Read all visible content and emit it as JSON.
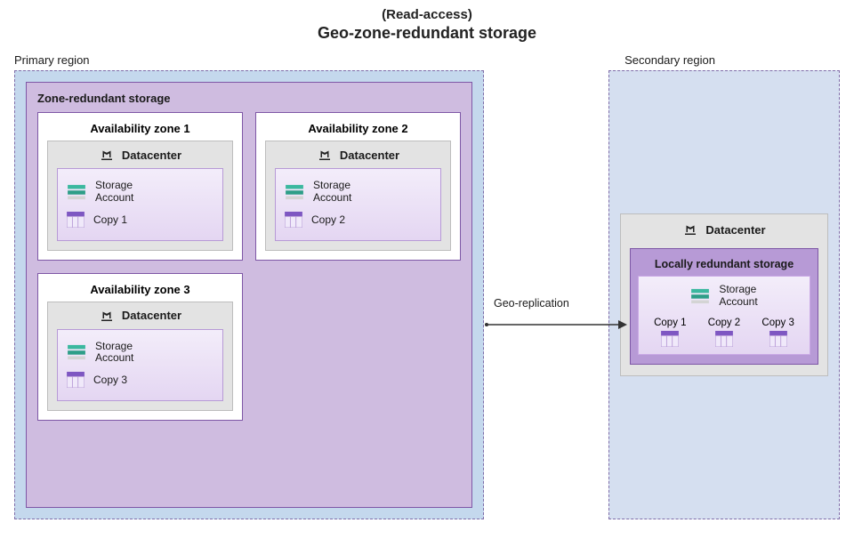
{
  "header": {
    "subtitle": "(Read-access)",
    "title": "Geo-zone-redundant storage"
  },
  "primary_region_label": "Primary region",
  "secondary_region_label": "Secondary region",
  "zrs_label": "Zone-redundant storage",
  "datacenter_label": "Datacenter",
  "storage_account_label": "Storage\nAccount",
  "zones": [
    {
      "title": "Availability zone 1",
      "copy": "Copy 1"
    },
    {
      "title": "Availability zone 2",
      "copy": "Copy 2"
    },
    {
      "title": "Availability zone 3",
      "copy": "Copy 3"
    }
  ],
  "geo_replication_label": "Geo-replication",
  "lrs_label": "Locally redundant storage",
  "secondary_copies": [
    {
      "label": "Copy 1"
    },
    {
      "label": "Copy 2"
    },
    {
      "label": "Copy 3"
    }
  ]
}
